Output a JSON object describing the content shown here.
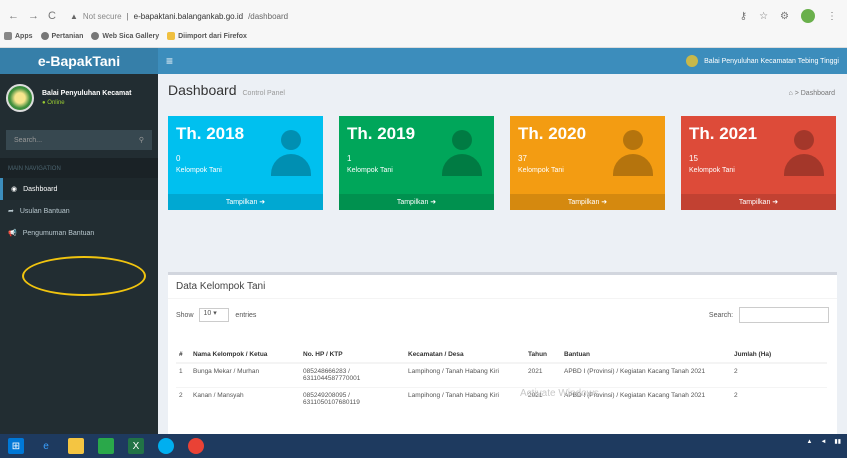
{
  "browser": {
    "nav_back": "←",
    "nav_fwd": "→",
    "nav_reload": "C",
    "security": "Not secure",
    "url_host": "e-bapaktani.balangankab.go.id",
    "url_path": "/dashboard"
  },
  "bookmarks": [
    "Apps",
    "Pertanian",
    "Web Sica Gallery",
    "Diimport dari Firefox"
  ],
  "sidebar": {
    "app_name": "e-BapakTani",
    "user_name": "Balai Penyuluhan Kecamat",
    "status": "Online",
    "search_placeholder": "Search...",
    "section_header": "MAIN NAVIGATION",
    "menu": [
      "Dashboard",
      "Usulan Bantuan",
      "Pengumuman Bantuan"
    ]
  },
  "topbar": {
    "menu_toggle": "≡",
    "user_label": "Balai Penyuluhan Kecamatan Tebing Tinggi"
  },
  "content": {
    "title": "Dashboard",
    "subtitle": "Control Panel",
    "breadcrumb": "Dashboard"
  },
  "boxes": [
    {
      "year": "Th. 2018",
      "count": "0",
      "label": "Kelompok Tani",
      "more": "Tampilkan",
      "color": "#00c0ef"
    },
    {
      "year": "Th. 2019",
      "count": "1",
      "label": "Kelompok Tani",
      "more": "Tampilkan",
      "color": "#00a65a"
    },
    {
      "year": "Th. 2020",
      "count": "37",
      "label": "Kelompok Tani",
      "more": "Tampilkan",
      "color": "#f39c12"
    },
    {
      "year": "Th. 2021",
      "count": "15",
      "label": "Kelompok Tani",
      "more": "Tampilkan",
      "color": "#dd4b39"
    }
  ],
  "table": {
    "title": "Data Kelompok Tani",
    "show_label": "Show",
    "entries_value": "10",
    "entries_label": "entries",
    "search_label": "Search:",
    "headers": [
      "#",
      "Nama Kelompok / Ketua",
      "No. HP / KTP",
      "Kecamatan / Desa",
      "Tahun",
      "Bantuan",
      "Jumlah (Ha)"
    ],
    "rows": [
      [
        "1",
        "Bunga Mekar / Murhan",
        "085248666283 / 6311044587770001",
        "Lampihong / Tanah Habang Kiri",
        "2021",
        "APBD I (Provinsi) / Kegiatan Kacang Tanah 2021",
        "2"
      ],
      [
        "2",
        "Kanan / Mansyah",
        "085249208095 / 6311050107680119",
        "Lampihong / Tanah Habang Kiri",
        "2021",
        "APBD I (Provinsi) / Kegiatan Kacang Tanah 2021",
        "2"
      ]
    ]
  },
  "watermark": "Activate Windows"
}
